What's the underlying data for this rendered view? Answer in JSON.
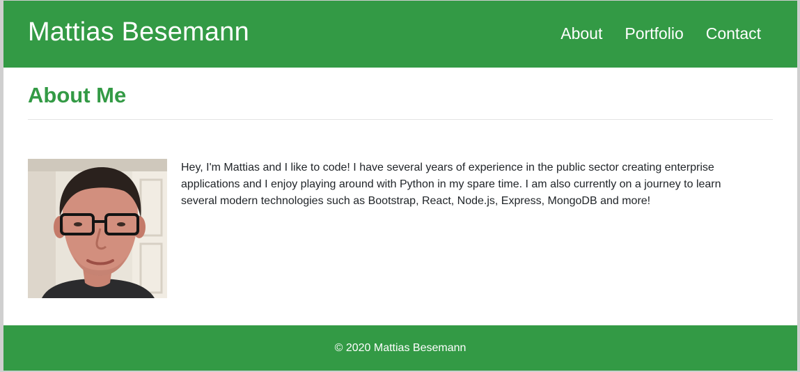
{
  "header": {
    "brand": "Mattias Besemann",
    "nav": [
      {
        "label": "About"
      },
      {
        "label": "Portfolio"
      },
      {
        "label": "Contact"
      }
    ]
  },
  "main": {
    "title": "About Me",
    "photo_icon": "profile-photo",
    "bio": "Hey, I'm Mattias and I like to code! I have several years of experience in the public sector creating enterprise applications and I enjoy playing around with Python in my spare time. I am also currently on a journey to learn several modern technologies such as Bootstrap, React, Node.js, Express, MongoDB and more!"
  },
  "footer": {
    "text": "© 2020 Mattias Besemann"
  },
  "colors": {
    "brand_green": "#339a45",
    "text": "#212529",
    "background": "#ffffff"
  }
}
